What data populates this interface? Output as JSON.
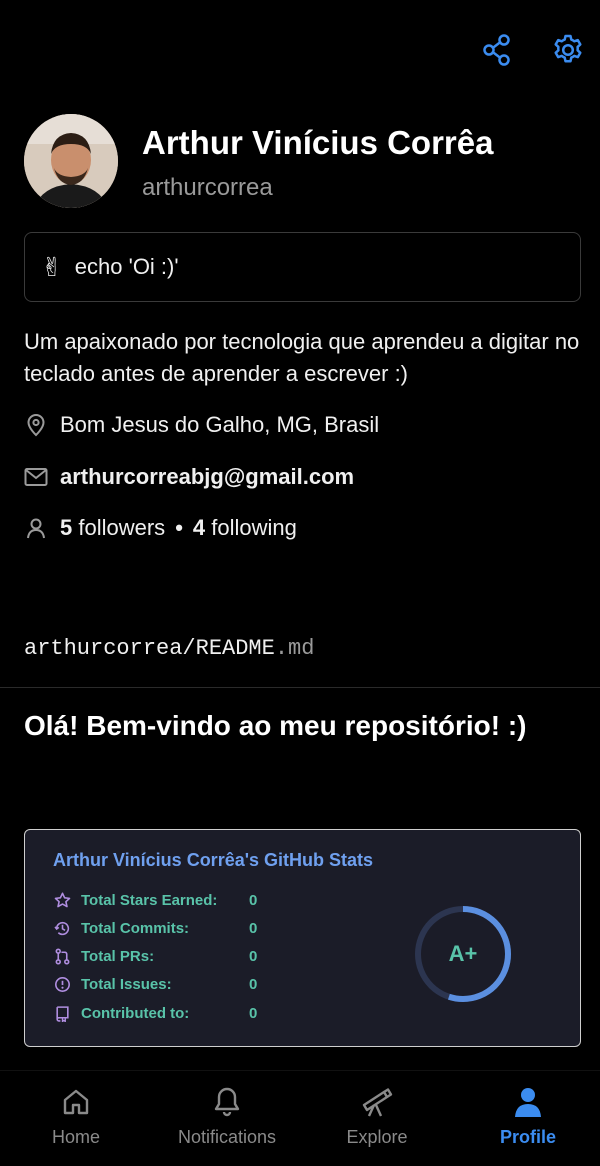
{
  "header": {
    "share_icon": "share-icon",
    "settings_icon": "gear-icon",
    "accent_color": "#3b8cf0"
  },
  "profile": {
    "name": "Arthur Vinícius Corrêa",
    "username": "arthurcorrea",
    "status_emoji": "✌",
    "status_text": "echo 'Oi :)'",
    "bio": "Um apaixonado por tecnologia que aprendeu a digitar no teclado antes de aprender a escrever :)",
    "location": "Bom Jesus do Galho, MG, Brasil",
    "email": "arthurcorreabjg@gmail.com",
    "followers_count": "5",
    "followers_label": "followers",
    "separator": "•",
    "following_count": "4",
    "following_label": "following"
  },
  "readme": {
    "path_main": "arthurcorrea/README",
    "path_ext": ".md",
    "title": "Olá! Bem-vindo ao meu repositório! :)"
  },
  "stats_card": {
    "title": "Arthur Vinícius Corrêa's GitHub Stats",
    "rows": [
      {
        "icon": "star-icon",
        "label": "Total Stars Earned:",
        "value": "0"
      },
      {
        "icon": "history-icon",
        "label": "Total Commits:",
        "value": "0"
      },
      {
        "icon": "pull-request-icon",
        "label": "Total PRs:",
        "value": "0"
      },
      {
        "icon": "issue-icon",
        "label": "Total Issues:",
        "value": "0"
      },
      {
        "icon": "repo-icon",
        "label": "Contributed to:",
        "value": "0"
      }
    ],
    "rank": "A+",
    "rank_progress": 0.55,
    "title_color": "#6fa0ef",
    "text_color": "#59c3a9",
    "icon_color": "#b08ee0"
  },
  "bottom_nav": [
    {
      "label": "Home",
      "icon": "home-icon"
    },
    {
      "label": "Notifications",
      "icon": "bell-icon"
    },
    {
      "label": "Explore",
      "icon": "telescope-icon"
    },
    {
      "label": "Profile",
      "icon": "person-icon",
      "active": true
    }
  ]
}
